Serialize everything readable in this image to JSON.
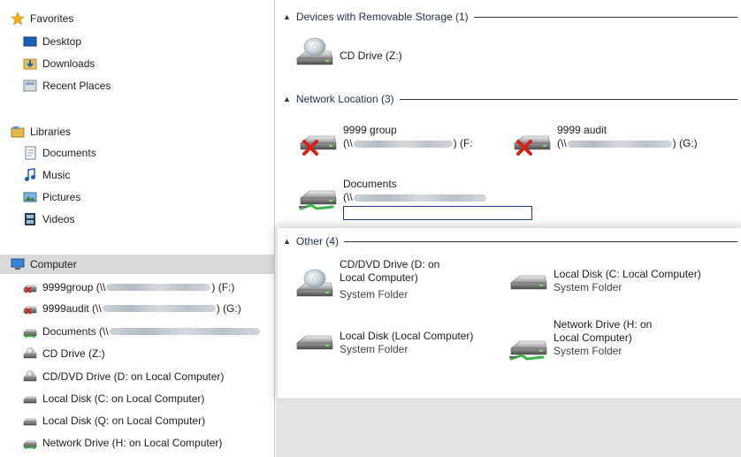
{
  "nav": {
    "favorites": {
      "label": "Favorites",
      "items": [
        {
          "label": "Desktop"
        },
        {
          "label": "Downloads"
        },
        {
          "label": "Recent Places"
        }
      ]
    },
    "libraries": {
      "label": "Libraries",
      "items": [
        {
          "label": "Documents"
        },
        {
          "label": "Music"
        },
        {
          "label": "Pictures"
        },
        {
          "label": "Videos"
        }
      ]
    },
    "computer": {
      "label": "Computer",
      "items": [
        {
          "prefix": "9999group (\\\\",
          "suffix": ") (F:)"
        },
        {
          "prefix": "9999audit (\\\\",
          "suffix": ") (G:)"
        },
        {
          "prefix": "Documents (\\\\",
          "suffix": ""
        },
        {
          "label": "CD Drive (Z:)"
        },
        {
          "label": "CD/DVD Drive (D: on Local Computer)"
        },
        {
          "label": "Local Disk (C: on Local Computer)"
        },
        {
          "label": "Local Disk (Q: on Local Computer)"
        },
        {
          "label": "Network Drive (H: on Local Computer)"
        }
      ]
    }
  },
  "groups": {
    "removable": {
      "header": "Devices with Removable Storage (1)",
      "items": [
        {
          "name": "CD Drive (Z:)"
        }
      ]
    },
    "network": {
      "header": "Network Location (3)",
      "items": [
        {
          "name": "9999 group",
          "path_prefix": "(\\\\",
          "path_suffix": ") (F:"
        },
        {
          "name": "9999 audit",
          "path_prefix": "(\\\\",
          "path_suffix": ") (G:)"
        },
        {
          "name": "Documents",
          "path_prefix": "(\\\\",
          "path_suffix": ""
        }
      ]
    },
    "other": {
      "header": "Other (4)",
      "items": [
        {
          "name_line1": "CD/DVD Drive (D: on",
          "name_line2": "Local Computer)",
          "type": "System Folder"
        },
        {
          "name": "Local Disk (C: Local Computer)",
          "type": "System Folder"
        },
        {
          "name": "Local Disk (Local Computer)",
          "type": "System Folder"
        },
        {
          "name_line1": "Network Drive (H: on",
          "name_line2": "Local Computer)",
          "type": "System Folder"
        }
      ]
    }
  },
  "icons": {
    "star": "favorites-star-icon",
    "drive": "hard-drive-icon",
    "cd": "cd-drive-icon",
    "disconnected": "disconnected-network-drive-icon",
    "network": "network-drive-icon"
  },
  "colors": {
    "accent": "#1f3f8f",
    "error_x": "#d42020",
    "net_green": "#3cb44b",
    "selected_bg": "#d9d9d9"
  }
}
